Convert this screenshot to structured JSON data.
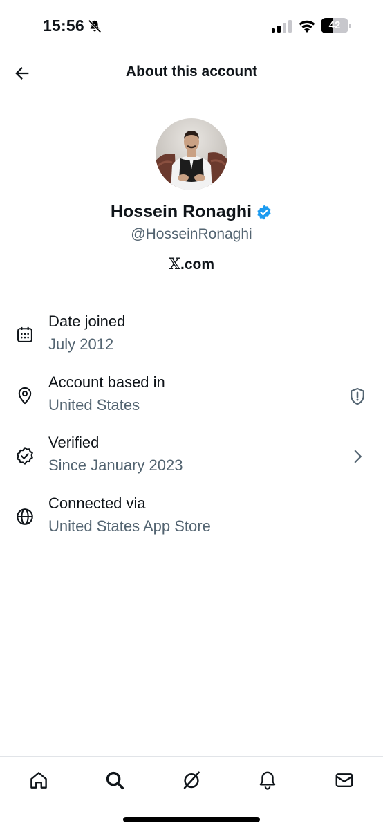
{
  "status_bar": {
    "time": "15:56",
    "battery_percent": "42",
    "battery_level": 0.42,
    "icons": [
      "bell-off-icon",
      "signal-icon",
      "wifi-icon",
      "battery-icon"
    ]
  },
  "header": {
    "title": "About this account",
    "back_icon": "arrow-left-icon"
  },
  "profile": {
    "name": "Hossein Ronaghi",
    "handle": "@HosseinRonaghi",
    "verified": true,
    "verified_color": "#1d9bf0",
    "site_logo": "𝕏",
    "site_suffix": ".com"
  },
  "info": {
    "date_joined": {
      "label": "Date joined",
      "value": "July 2012",
      "icon": "calendar-icon"
    },
    "account_based": {
      "label": "Account based in",
      "value": "United States",
      "icon": "location-pin-icon",
      "trailing_icon": "shield-alert-icon"
    },
    "verified": {
      "label": "Verified",
      "value": "Since January 2023",
      "icon": "verified-badge-outline-icon",
      "trailing_icon": "chevron-right-icon"
    },
    "connected": {
      "label": "Connected via",
      "value": "United States App Store",
      "icon": "globe-icon"
    }
  },
  "bottom_nav": {
    "items": [
      "home-icon",
      "search-icon",
      "grok-icon",
      "notifications-bell-icon",
      "messages-envelope-icon"
    ]
  },
  "colors": {
    "text_primary": "#0f1419",
    "text_secondary": "#536471",
    "accent": "#1d9bf0"
  }
}
